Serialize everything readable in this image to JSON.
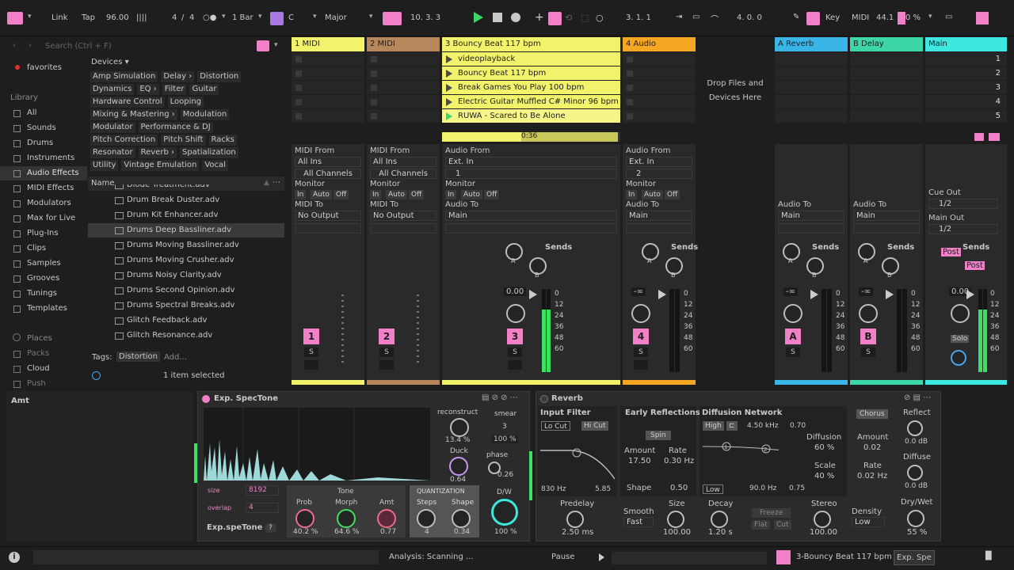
{
  "transport": {
    "link": "Link",
    "tap": "Tap",
    "bpm": "96.00",
    "sig_num": "4",
    "sig_slash": "/",
    "sig_den": "4",
    "quant": "1 Bar",
    "key": "C",
    "scale": "Major",
    "position": "10.  3.  3",
    "loop_start": "3.  1.  1",
    "loop_len": "4.  0.  0",
    "key_label": "Key",
    "midi_label": "MIDI",
    "sample_rate": "44.1",
    "cpu": "0 %"
  },
  "browser": {
    "search_placeholder": "Search (Ctrl + F)",
    "favorites": "favorites",
    "library_label": "Library",
    "library": [
      "All",
      "Sounds",
      "Drums",
      "Instruments",
      "Audio Effects",
      "MIDI Effects",
      "Modulators",
      "Max for Live",
      "Plug-Ins",
      "Clips",
      "Samples",
      "Grooves",
      "Tunings",
      "Templates"
    ],
    "places_label": "Places",
    "places": [
      "Packs",
      "Cloud",
      "Push"
    ],
    "devices_header": "Devices ▾",
    "tags_row1": [
      "Amp Simulation",
      "Delay ›",
      "Distortion"
    ],
    "tags_row2": [
      "Dynamics",
      "EQ ›",
      "Filter",
      "Guitar"
    ],
    "tags_row3": [
      "Hardware Control",
      "Looping"
    ],
    "tags_row4": [
      "Mixing & Mastering ›",
      "Modulation"
    ],
    "tags_row5": [
      "Modulator",
      "Performance & DJ"
    ],
    "tags_row6": [
      "Pitch Correction",
      "Pitch Shift",
      "Racks"
    ],
    "tags_row7": [
      "Resonator",
      "Reverb ›",
      "Spatialization"
    ],
    "tags_row8": [
      "Utility",
      "Vintage Emulation",
      "Vocal"
    ],
    "name_header": "Name",
    "files": [
      "Diode Treatment.adv",
      "Drum Break Duster.adv",
      "Drum Kit Enhancer.adv",
      "Drums Deep Bassliner.adv",
      "Drums Moving Bassliner.adv",
      "Drums Moving Crusher.adv",
      "Drums Noisy Clarity.adv",
      "Drums Second Opinion.adv",
      "Drums Spectral Breaks.adv",
      "Glitch Feedback.adv",
      "Glitch Resonance.adv"
    ],
    "tags_label": "Tags:",
    "tag_value": "Distortion",
    "tag_add": "Add...",
    "status": "1 item selected"
  },
  "tracks": {
    "t1": "1 MIDI",
    "t2": "2 MIDI",
    "t3": "3 Bouncy Beat 117 bpm",
    "t4": "4 Audio",
    "tA": "A Reverb",
    "tB": "B Delay",
    "main": "Main",
    "drop_text": "Drop Files and Devices Here",
    "clips": [
      "videoplayback",
      "Bouncy Beat 117 bpm",
      "Break Games You Play 100 bpm",
      "Electric Guitar Muffled C# Minor 96 bpm",
      "RUWA - Scared to Be Alone"
    ],
    "clip_time": "0:36",
    "scenes": [
      "1",
      "2",
      "3",
      "4",
      "5"
    ]
  },
  "io": {
    "midi_from": "MIDI From",
    "all_ins": "All Ins",
    "all_channels": "All Channels",
    "monitor": "Monitor",
    "in": "In",
    "auto": "Auto",
    "off": "Off",
    "midi_to": "MIDI To",
    "no_output": "No Output",
    "audio_from": "Audio From",
    "ext_in": "Ext. In",
    "ch1": "1",
    "ch2": "2",
    "audio_to": "Audio To",
    "main": "Main",
    "cue_out": "Cue Out",
    "cue_val": "1/2",
    "main_out": "Main Out",
    "main_val": "1/2"
  },
  "mixer": {
    "sends": "Sends",
    "a": "A",
    "b": "B",
    "post": "Post",
    "vol3": "0.00",
    "vol4": "-∞",
    "volA": "-∞",
    "volB": "-∞",
    "volM": "0.00",
    "scale": [
      "0",
      "12",
      "24",
      "36",
      "48",
      "60"
    ],
    "s": "S",
    "solo": "Solo",
    "n1": "1",
    "n2": "2",
    "n3": "3",
    "n4": "4",
    "nA": "A",
    "nB": "B"
  },
  "detail": {
    "amt": "Amt"
  },
  "spectone": {
    "title": "Exp. SpecTone",
    "reconstruct": "reconstruct",
    "recon_val": "13.4 %",
    "smear": "smear",
    "smear_val": "3",
    "smear_pct": "100 %",
    "duck": "Duck",
    "duck_val": "0.64",
    "phase": "phase",
    "phase_val": "0.26",
    "dw": "D/W",
    "dw_val": "100 %",
    "size": "size",
    "size_val": "8192",
    "overlap": "overlap",
    "overlap_val": "4",
    "name": "Exp.speTone",
    "help": "?",
    "tone": "Tone",
    "prob": "Prob",
    "prob_val": "40.2 %",
    "morph": "Morph",
    "morph_val": "64.6 %",
    "amt": "Amt",
    "amt_val": "0.77",
    "quant": "QUANTIZATION",
    "steps": "Steps",
    "steps_val": "4",
    "shape": "Shape",
    "shape_val": "0.34"
  },
  "reverb": {
    "title": "Reverb",
    "input_filter": "Input Filter",
    "lo_cut": "Lo Cut",
    "hi_cut": "Hi Cut",
    "lo_freq": "830 Hz",
    "hi_freq": "5.85",
    "early": "Early Reflections",
    "spin": "Spin",
    "amount": "Amount",
    "amount_val": "17.50",
    "rate": "Rate",
    "rate_val": "0.30 Hz",
    "shape": "Shape",
    "shape_val": "0.50",
    "diffusion_net": "Diffusion Network",
    "high": "High",
    "high_freq": "4.50 kHz",
    "high_val": "0.70",
    "low": "Low",
    "low_freq": "90.0 Hz",
    "low_val": "0.75",
    "diffusion": "Diffusion",
    "diffusion_val": "60 %",
    "scale": "Scale",
    "scale_val": "40 %",
    "chorus": "Chorus",
    "ch_amount": "Amount",
    "ch_amount_val": "0.02",
    "ch_rate": "Rate",
    "ch_rate_val": "0.02 Hz",
    "reflect": "Reflect",
    "reflect_val": "0.0 dB",
    "diffuse": "Diffuse",
    "diffuse_val": "0.0 dB",
    "predelay": "Predelay",
    "predelay_val": "2.50 ms",
    "smooth": "Smooth",
    "smooth_val": "Fast",
    "size": "Size",
    "size_val": "100.00",
    "decay": "Decay",
    "decay_val": "1.20 s",
    "freeze": "Freeze",
    "flat": "Flat",
    "cut": "Cut",
    "stereo": "Stereo",
    "stereo_val": "100.00",
    "density": "Density",
    "density_val": "Low",
    "drywet": "Dry/Wet",
    "drywet_val": "55 %"
  },
  "statusbar": {
    "analysis": "Analysis: Scanning ...",
    "pause": "Pause",
    "track": "3-Bouncy Beat 117 bpm",
    "device": "Exp. Spe"
  }
}
